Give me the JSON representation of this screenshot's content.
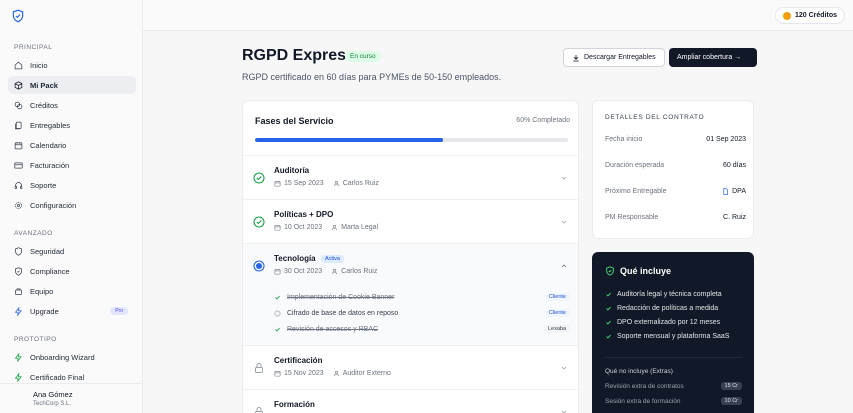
{
  "sidebar": {
    "sections": [
      {
        "label": "PRINCIPAL",
        "items": [
          {
            "label": "Inicio",
            "icon": "home-icon"
          },
          {
            "label": "Mi Pack",
            "icon": "package-icon",
            "active": true
          },
          {
            "label": "Créditos",
            "icon": "coins-icon"
          },
          {
            "label": "Entregables",
            "icon": "files-icon"
          },
          {
            "label": "Calendario",
            "icon": "calendar-icon"
          },
          {
            "label": "Facturación",
            "icon": "credit-card-icon"
          },
          {
            "label": "Soporte",
            "icon": "headset-icon"
          },
          {
            "label": "Configuración",
            "icon": "gear-icon"
          }
        ]
      },
      {
        "label": "AVANZADO",
        "items": [
          {
            "label": "Seguridad",
            "icon": "shield-icon"
          },
          {
            "label": "Compliance",
            "icon": "shield-check-icon"
          },
          {
            "label": "Equipo",
            "icon": "team-icon"
          },
          {
            "label": "Upgrade",
            "icon": "zap-icon",
            "badge": "Pro"
          }
        ]
      },
      {
        "label": "PROTOTIPO",
        "items": [
          {
            "label": "Onboarding Wizard",
            "icon": "zap-icon"
          },
          {
            "label": "Certificado Final",
            "icon": "zap-icon"
          }
        ]
      }
    ],
    "user": {
      "name": "Ana Gómez",
      "org": "TechCorp S.L."
    }
  },
  "topbar": {
    "credits": "120 Créditos"
  },
  "header": {
    "title": "RGPD Express",
    "status": "En curso",
    "subtitle": "RGPD certificado en 60 días para PYMEs de 50-150 empleados.",
    "download_label": "Descargar Entregables",
    "expand_label": "Ampliar cobertura →"
  },
  "phases": {
    "title": "Fases del Servicio",
    "progress_label": "60% Completado",
    "progress": 0.6,
    "items": [
      {
        "name": "Auditoría",
        "date": "15 Sep 2023",
        "owner": "Carlos Ruiz",
        "state": "done"
      },
      {
        "name": "Políticas + DPO",
        "date": "10 Oct 2023",
        "owner": "Marta Legal",
        "state": "done"
      },
      {
        "name": "Tecnología",
        "badge": "Activa",
        "date": "30 Oct 2023",
        "owner": "Carlos Ruiz",
        "state": "active",
        "tasks": [
          {
            "label": "Implementación de Cookie Banner",
            "tag": "Cliente",
            "done": true
          },
          {
            "label": "Cifrado de base de datos en reposo",
            "tag": "Cliente",
            "done": false
          },
          {
            "label": "Revisión de accesos y RBAC",
            "tag": "Lexaba",
            "done": true
          }
        ]
      },
      {
        "name": "Certificación",
        "date": "15 Nov 2023",
        "owner": "Auditor Externo",
        "state": "locked"
      },
      {
        "name": "Formación",
        "state": "locked"
      }
    ]
  },
  "contract": {
    "label": "DETALLES DEL CONTRATO",
    "rows": [
      {
        "k": "Fecha inicio",
        "v": "01 Sep 2023"
      },
      {
        "k": "Duración esperada",
        "v": "60 días"
      },
      {
        "k": "Próximo Entregable",
        "v": "DPA"
      },
      {
        "k": "PM Responsable",
        "v": "C. Ruiz"
      }
    ]
  },
  "includes": {
    "title": "Qué incluye",
    "items": [
      "Auditoría legal y técnica completa",
      "Redacción de políticas a medida",
      "DPO externalizado por 12 meses",
      "Soporte mensual y plataforma SaaS"
    ],
    "not_included_label": "Qué no incluye (Extras)",
    "extras": [
      {
        "label": "Revisión extra de contratos",
        "credits": "15 Cr"
      },
      {
        "label": "Sesión extra de formación",
        "credits": "10 Cr"
      }
    ]
  },
  "colors": {
    "accent": "#2563eb",
    "success": "#16a34a",
    "dark": "#111827"
  }
}
